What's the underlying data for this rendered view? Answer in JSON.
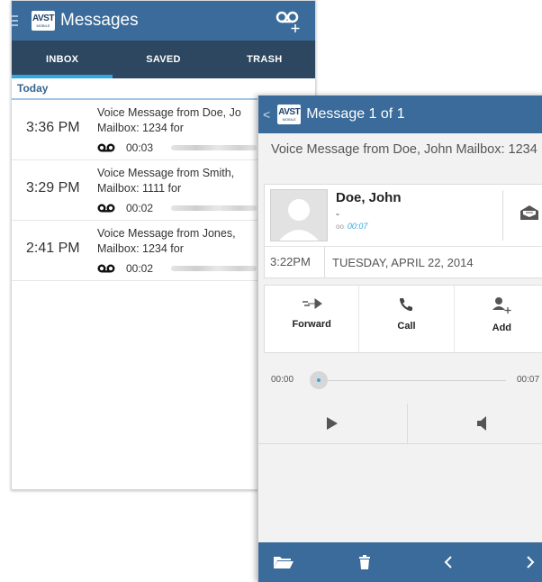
{
  "colors": {
    "appbar": "#3a6b9a",
    "tabs": "#2d4760",
    "accent": "#33a7e0"
  },
  "inbox": {
    "title": "Messages",
    "logo_text": "AVST",
    "logo_sub": "MOBILE",
    "tabs": [
      {
        "label": "INBOX",
        "active": true
      },
      {
        "label": "SAVED",
        "active": false
      },
      {
        "label": "TRASH",
        "active": false
      }
    ],
    "section": "Today",
    "messages": [
      {
        "time": "3:36 PM",
        "line1": "Voice Message from Doe, Jo",
        "line2": "Mailbox: 1234 for",
        "duration": "00:03"
      },
      {
        "time": "3:29 PM",
        "line1": "Voice Message from Smith,",
        "line2": "Mailbox: 1111 for",
        "duration": "00:02"
      },
      {
        "time": "2:41 PM",
        "line1": "Voice Message from Jones,",
        "line2": "Mailbox: 1234 for",
        "duration": "00:02"
      }
    ]
  },
  "detail": {
    "title": "Message 1 of 1",
    "back_glyph": "<",
    "subject": "Voice Message from Doe, John Mailbox: 1234",
    "contact": {
      "name": "Doe, John",
      "dash": "-",
      "duration": "00:07",
      "mini_icon": "oo"
    },
    "time": "3:22PM",
    "date": "TUESDAY, APRIL 22, 2014",
    "actions": [
      {
        "label": "Forward",
        "icon": "forward-icon"
      },
      {
        "label": "Call",
        "icon": "phone-icon"
      },
      {
        "label": "Add",
        "icon": "add-contact-icon"
      }
    ],
    "player": {
      "start": "00:00",
      "end": "00:07",
      "progress": 0
    }
  }
}
